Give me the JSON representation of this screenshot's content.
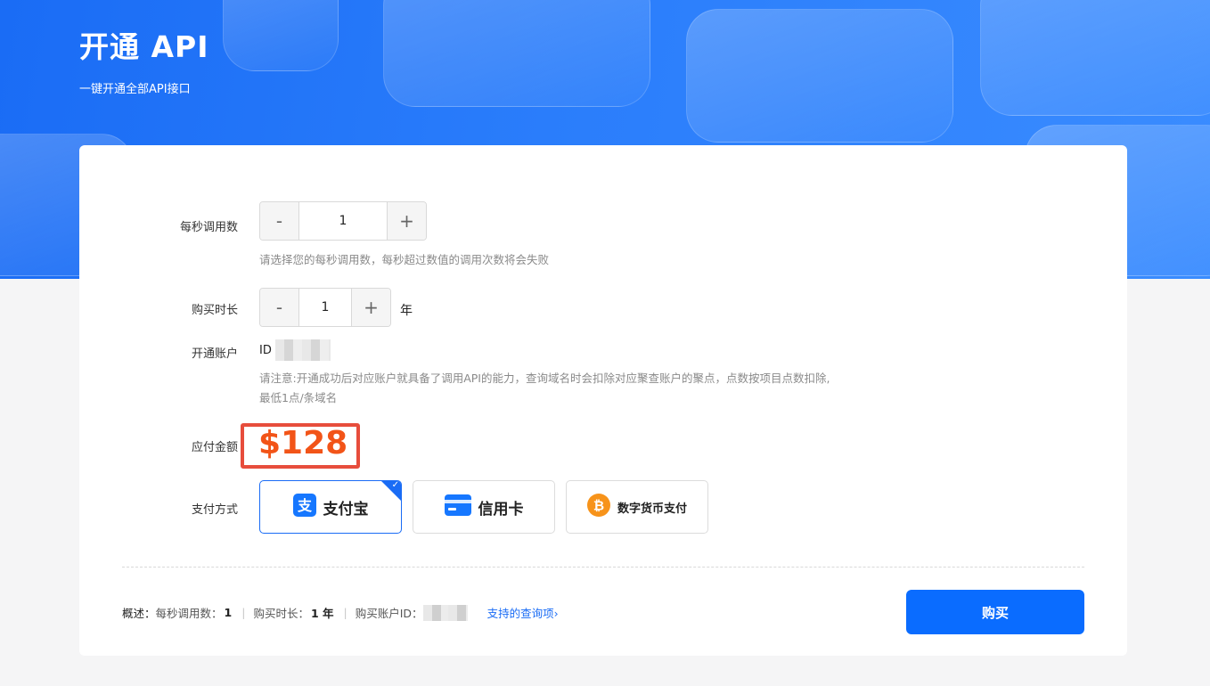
{
  "hero": {
    "title": "开通 API",
    "subtitle": "一键开通全部API接口"
  },
  "form": {
    "qps": {
      "label": "每秒调用数",
      "minus": "-",
      "value": "1",
      "plus": "+",
      "hint": "请选择您的每秒调用数，每秒超过数值的调用次数将会失败"
    },
    "duration": {
      "label": "购买时长",
      "minus": "-",
      "value": "1",
      "plus": "+",
      "unit": "年"
    },
    "account": {
      "label": "开通账户",
      "id_prefix": "ID",
      "hint_line1": "请注意:开通成功后对应账户就具备了调用API的能力，查询域名时会扣除对应聚查账户的聚点，点数按项目点数扣除,",
      "hint_line2": "最低1点/条域名"
    },
    "amount": {
      "label": "应付金额",
      "price": "$128"
    },
    "payment": {
      "label": "支付方式",
      "options": [
        {
          "label": "支付宝",
          "icon": "alipay-icon",
          "selected": true
        },
        {
          "label": "信用卡",
          "icon": "credit-card-icon",
          "selected": false
        },
        {
          "label": "数字货币支付",
          "icon": "bitcoin-icon",
          "selected": false
        }
      ]
    }
  },
  "summary": {
    "prefix": "概述：",
    "qps_label": "每秒调用数：",
    "qps_value": "1",
    "duration_label": "购买时长：",
    "duration_value": "1 年",
    "account_label": "购买账户ID：",
    "link": "支持的查询项",
    "link_chevron": "›"
  },
  "buy_button": "购买",
  "colors": {
    "primary": "#0a6cff",
    "price": "#f25418",
    "highlight_box": "#e74d3c",
    "alipay": "#1677ff",
    "bitcoin": "#f7931a"
  }
}
